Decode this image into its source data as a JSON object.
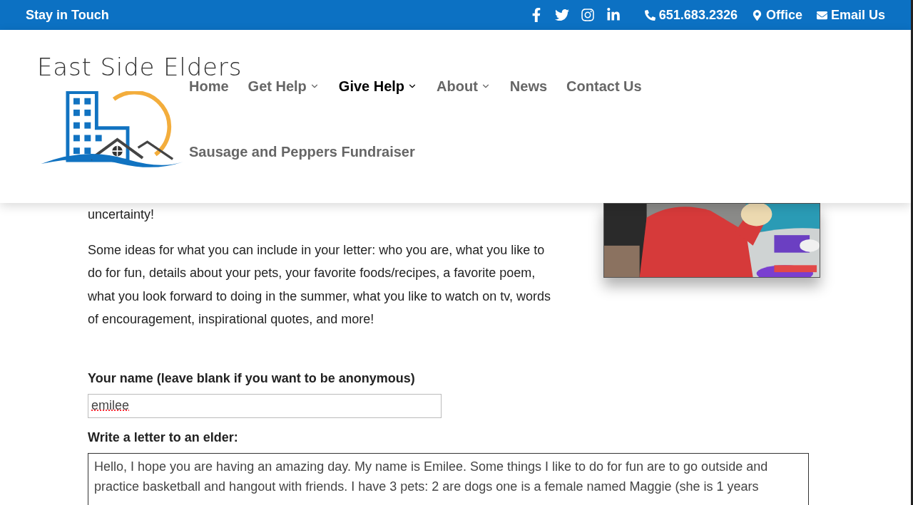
{
  "top_bar": {
    "tagline": "Stay in Touch",
    "social": [
      {
        "kind": "facebook"
      },
      {
        "kind": "twitter"
      },
      {
        "kind": "instagram"
      },
      {
        "kind": "linkedin"
      }
    ],
    "contacts": [
      {
        "kind": "phone",
        "label": "651.683.2326"
      },
      {
        "kind": "location",
        "label": "Office"
      },
      {
        "kind": "email",
        "label": "Email Us"
      }
    ]
  },
  "logo": {
    "text": "East Side Elders"
  },
  "nav": {
    "items": [
      {
        "label": "Home",
        "has_menu": false,
        "selected": false
      },
      {
        "label": "Get Help",
        "has_menu": true,
        "selected": false
      },
      {
        "label": "Give Help",
        "has_menu": true,
        "selected": true
      },
      {
        "label": "About",
        "has_menu": true,
        "selected": false
      },
      {
        "label": "News",
        "has_menu": false,
        "selected": false
      },
      {
        "label": "Contact Us",
        "has_menu": false,
        "selected": false
      }
    ],
    "second_row": [
      "Sausage and Peppers Fundraiser"
    ]
  },
  "content": {
    "paragraphs": [
      "uncertainty!",
      "Some ideas for what you can include in your letter:  who you are, what you like to do for fun, details about your pets, your favorite foods/recipes, a favorite poem, what you look forward to doing in the summer, what you like to watch on tv, words of encouragement, inspirational quotes, and more!"
    ],
    "photo": {
      "kind": "picture"
    }
  },
  "form": {
    "name_label": "Your name (leave blank if you want to be anonymous)",
    "name_value": "emilee",
    "letter_label": "Write a letter to an elder:",
    "letter_value": "Hello, I hope you are having an amazing day. My name is Emilee. Some things I like to do for fun are to go outside and practice basketball and hangout with friends. I have 3 pets: 2 are dogs one is a female named Maggie (she is 1 years"
  }
}
